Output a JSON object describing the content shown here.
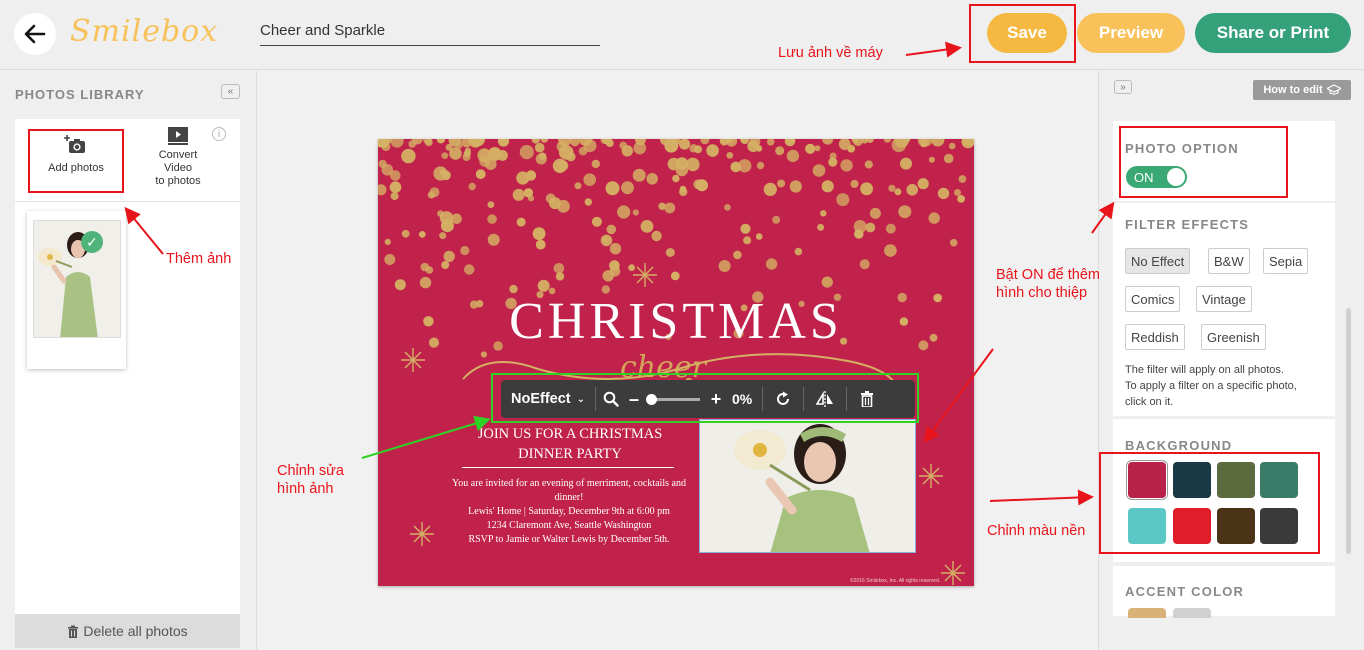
{
  "header": {
    "logo": "Smilebox",
    "title_value": "Cheer and Sparkle",
    "save_label": "Save",
    "preview_label": "Preview",
    "share_label": "Share or Print"
  },
  "library": {
    "title": "PHOTOS LIBRARY",
    "add_photos": "Add photos",
    "convert_video_lines": [
      "Convert",
      "Video",
      "to photos"
    ],
    "delete_all": "Delete all photos"
  },
  "card": {
    "title": "CHRISTMAS",
    "script": "cheer",
    "join_lines": [
      "JOIN US FOR A CHRISTMAS",
      "DINNER PARTY"
    ],
    "details_lines": [
      "You are invited for an evening of merriment, cocktails and",
      "dinner!",
      "Lewis' Home | Saturday, December 9th at 6:00 pm",
      "1234 Claremont Ave, Seattle Washington",
      "RSVP to Jamie or Walter Lewis by December 5th."
    ],
    "copyright": "©2016 Smilebox, Inc. All rights reserved.",
    "background_color": "#c0224b",
    "confetti_color": "#d4b064"
  },
  "photo_toolbar": {
    "effect": "NoEffect",
    "zoom_percent": 0,
    "zoom_label": "0%"
  },
  "right_panel": {
    "how_to_edit": "How to edit",
    "photo_option": {
      "heading": "PHOTO OPTION",
      "toggle_label": "ON",
      "toggle_on": true
    },
    "filter_effects": {
      "heading": "FILTER EFFECTS",
      "options": [
        "No Effect",
        "B&W",
        "Sepia",
        "Comics",
        "Vintage",
        "Reddish",
        "Greenish"
      ],
      "selected": "No Effect",
      "note_lines": [
        "The filter will apply on all photos.",
        "To apply a filter on a specific photo,",
        "click on it."
      ]
    },
    "background": {
      "heading": "BACKGROUND",
      "swatches": [
        "#b7214a",
        "#1b3a47",
        "#5b6b3d",
        "#3a7c67",
        "#5cc8c6",
        "#e01e2a",
        "#4b3317",
        "#3a3a3a"
      ],
      "selected_index": 0
    },
    "accent_color": {
      "heading": "ACCENT COLOR",
      "swatches": [
        "#d9b27a",
        "#d0d0d0"
      ]
    }
  },
  "annotations": {
    "save_note": "Lưu ảnh về máy",
    "add_photo_note": "Thêm ảnh",
    "edit_photo_note": [
      "Chỉnh sửa",
      "hình ảnh"
    ],
    "photo_option_note": [
      "Bật ON để thêm",
      "hình cho thiệp"
    ],
    "background_note": "Chỉnh màu nền",
    "red": "#e8141b",
    "green": "#2fd224"
  },
  "colors": {
    "save": "#f5b942",
    "preview": "#f8c15a",
    "share": "#35a17b",
    "toggle": "#3aa873"
  }
}
